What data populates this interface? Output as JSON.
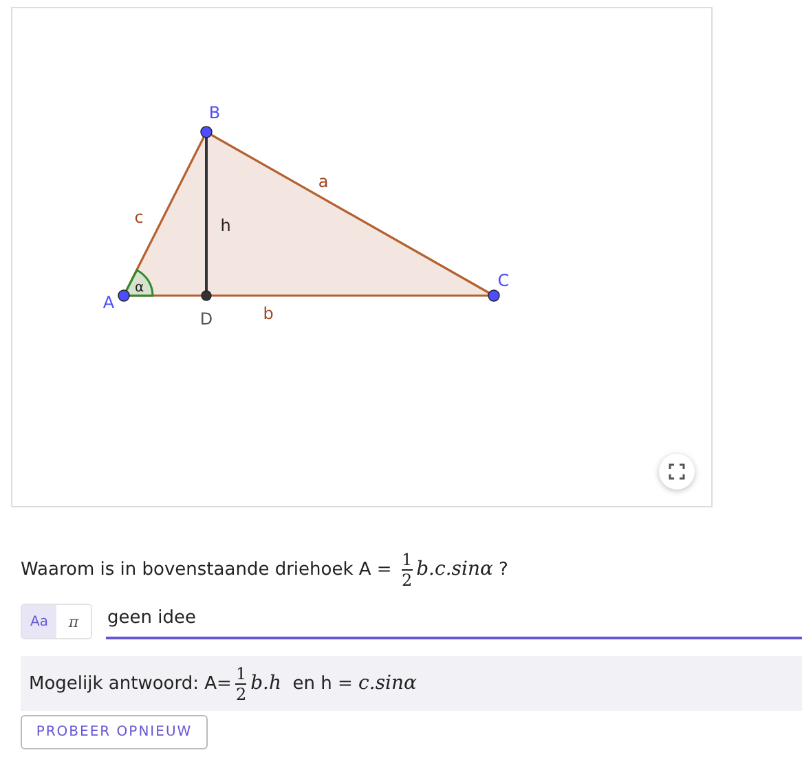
{
  "graph": {
    "points": [
      {
        "label": "A",
        "kind": "vertex"
      },
      {
        "label": "B",
        "kind": "vertex"
      },
      {
        "label": "C",
        "kind": "vertex"
      },
      {
        "label": "D",
        "kind": "foot"
      }
    ],
    "sides": [
      {
        "label": "a"
      },
      {
        "label": "b"
      },
      {
        "label": "c"
      },
      {
        "label": "h"
      }
    ],
    "angle": {
      "label": "α"
    }
  },
  "question": [
    {
      "kind": "text",
      "text": "Waarom is in bovenstaande driehoek A = "
    },
    {
      "kind": "frac",
      "num": "1",
      "den": "2"
    },
    {
      "kind": "math",
      "text": "b.c.sinα"
    },
    {
      "kind": "text",
      "text": " ?"
    }
  ],
  "input": {
    "modes": [
      {
        "label": "Aa",
        "selected": true
      },
      {
        "label": "π",
        "selected": false
      }
    ],
    "value": "geen idee"
  },
  "answer": [
    {
      "kind": "text",
      "text": "Mogelijk antwoord: A="
    },
    {
      "kind": "frac",
      "num": "1",
      "den": "2"
    },
    {
      "kind": "math",
      "text": "b.h"
    },
    {
      "kind": "text",
      "text": "  en h = "
    },
    {
      "kind": "math",
      "text": "c.sinα"
    }
  ],
  "button": "PROBEER OPNIEUW"
}
